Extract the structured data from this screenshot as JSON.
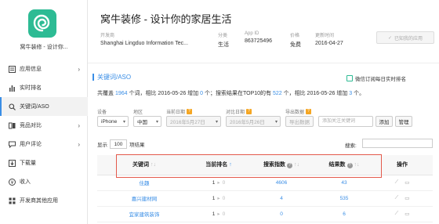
{
  "app": {
    "short_name": "窝牛装修 - 设计你...",
    "title": "窝牛装修 - 设计你的家居生活",
    "icon": "snail-swirl-icon",
    "brand_color": "#2dbb94"
  },
  "sidebar": {
    "items": [
      {
        "label": "应用信息",
        "icon": "list-icon",
        "has_chevron": true
      },
      {
        "label": "实时排名",
        "icon": "bar-chart-icon",
        "has_chevron": false
      },
      {
        "label": "关键词/ASO",
        "icon": "search-icon",
        "has_chevron": false,
        "active": true
      },
      {
        "label": "竞品对比",
        "icon": "compare-icon",
        "has_chevron": true
      },
      {
        "label": "用户评论",
        "icon": "comment-icon",
        "has_chevron": true
      },
      {
        "label": "下载量",
        "icon": "download-icon",
        "has_chevron": false
      },
      {
        "label": "收入",
        "icon": "money-icon",
        "has_chevron": false
      },
      {
        "label": "开发商其他应用",
        "icon": "apps-icon",
        "has_chevron": false
      }
    ]
  },
  "meta": {
    "developer_key": "开发商",
    "developer": "Shanghai Lingduo Information Tec...",
    "category_key": "分类",
    "category": "生活",
    "appid_key": "App ID",
    "appid": "863725496",
    "price_key": "价格",
    "price": "免费",
    "updated_key": "更新时间",
    "updated": "2016-04-27",
    "claim_label": "已知我的应用"
  },
  "aso": {
    "section_title": "关键词/ASO",
    "wechat_label": "微信订阅每日实时排名",
    "summary": {
      "p1": "共覆盖 ",
      "total": "1964",
      "p2": " 个词，相比 2016-05-26 增加 ",
      "added": "0",
      "p3": " 个；搜索结果在TOP10的有 ",
      "top10": "522",
      "p4": " 个，相比 2016-05-26 增加 ",
      "top10_added": "3",
      "p5": " 个。"
    },
    "filters": {
      "device_label": "设备",
      "device": "iPhone",
      "region_label": "地区",
      "region": "中国",
      "date_label": "当前日期",
      "date": "2016年5月27日",
      "cmp_label": "对比日期",
      "cmp_date": "2016年5月26日",
      "export_label": "导出数据",
      "export_btn": "导出数据",
      "add_placeholder": "添加关注关键词",
      "add_btn": "添加",
      "manage_btn": "管理"
    },
    "table_controls": {
      "show": "显示",
      "count": "100",
      "rows": "项结果",
      "search": "搜索:"
    },
    "columns": {
      "keyword": "关键词",
      "rank": "当前排名",
      "index": "搜索指数",
      "results": "结果数",
      "ops": "操作"
    },
    "rows": [
      {
        "keyword": "住趣",
        "rank": "1",
        "change": "0",
        "index": "4606",
        "results": "43"
      },
      {
        "keyword": "嘉兴建材网",
        "rank": "1",
        "change": "0",
        "index": "4",
        "results": "535"
      },
      {
        "keyword": "宜家建筑装饰",
        "rank": "1",
        "change": "0",
        "index": "0",
        "results": "6"
      }
    ]
  }
}
